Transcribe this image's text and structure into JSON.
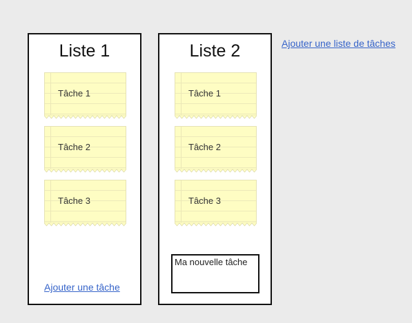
{
  "lists": [
    {
      "title": "Liste 1",
      "tasks": [
        "Tâche 1",
        "Tâche 2",
        "Tâche 3"
      ],
      "add_task_label": "Ajouter une tâche"
    },
    {
      "title": "Liste 2",
      "tasks": [
        "Tâche 1",
        "Tâche 2",
        "Tâche 3"
      ],
      "new_task_value": "Ma nouvelle tâche"
    }
  ],
  "add_list_label": "Ajouter une liste de tâches",
  "colors": {
    "background": "#ebebeb",
    "note_fill": "#fefdc3",
    "note_lines": "#ece9b9",
    "link": "#3563c9",
    "border": "#111111"
  }
}
